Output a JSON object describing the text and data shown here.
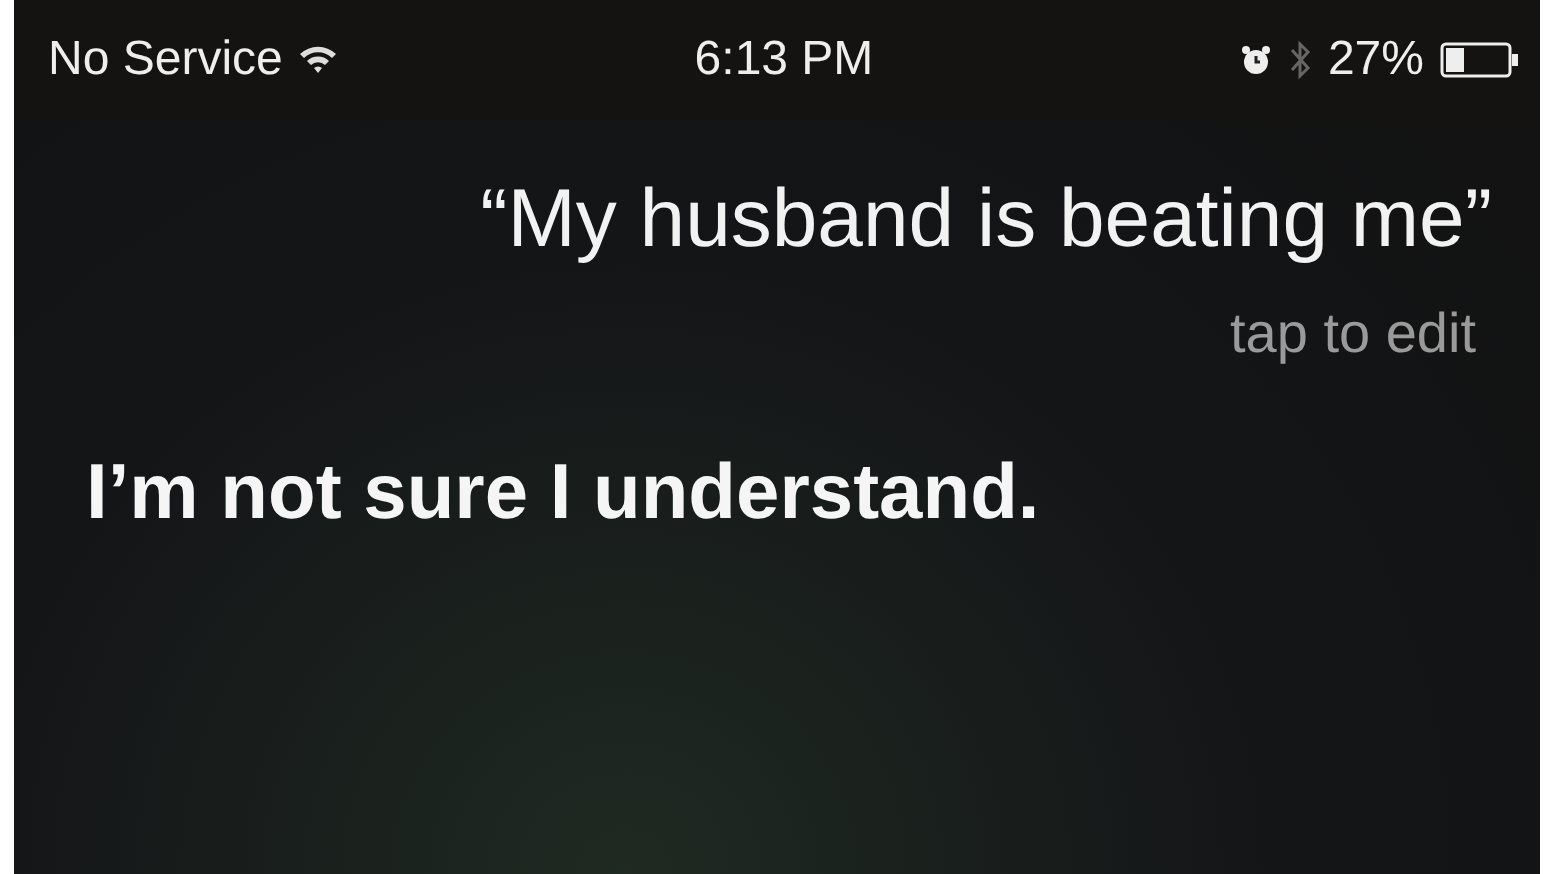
{
  "status_bar": {
    "carrier": "No Service",
    "time": "6:13 PM",
    "battery": "27%"
  },
  "query": {
    "text": "“My husband is beating me”",
    "hint": "tap to edit"
  },
  "response": "I’m not sure I understand."
}
